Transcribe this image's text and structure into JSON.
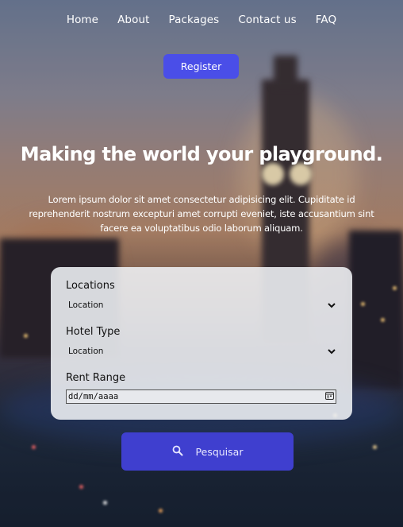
{
  "nav": {
    "items": [
      "Home",
      "About",
      "Packages",
      "Contact us",
      "FAQ"
    ]
  },
  "header": {
    "register_label": "Register"
  },
  "hero": {
    "title": "Making the world your playground.",
    "lead": "Lorem ipsum dolor sit amet consectetur adipisicing elit. Cupiditate id reprehenderit nostrum excepturi amet corrupti eveniet, iste accusantium sint facere ea voluptatibus odio laborum aliquam."
  },
  "form": {
    "locations": {
      "label": "Locations",
      "selected": "Location"
    },
    "hotel_type": {
      "label": "Hotel Type",
      "selected": "Location"
    },
    "rent_range": {
      "label": "Rent Range",
      "placeholder": "dd/mm/aaaa"
    },
    "submit_label": "Pesquisar"
  },
  "colors": {
    "accent": "#4a4ee8",
    "submit": "#3f3fcf"
  },
  "icons": {
    "select_arrow": "chevron-down-icon",
    "date_picker": "calendar-icon",
    "search": "search-icon"
  }
}
